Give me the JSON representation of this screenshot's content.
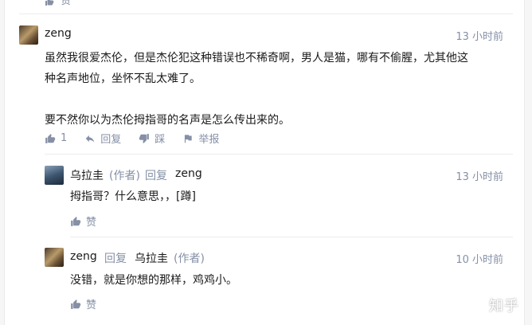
{
  "comments": [
    {
      "author": "zeng",
      "time": "13 小时前",
      "text_line1": "虽然我很爱杰伦，但是杰伦犯这种错误也不稀奇啊，男人是猫，哪有不偷腥，尤其他这",
      "text_line2": "种名声地位，坐怀不乱太难了。",
      "text_line3": "要不然你以为杰伦拇指哥的名声是怎么传出来的。",
      "likes": "1",
      "reply_label": "回复",
      "dislike_label": "踩",
      "report_label": "举报"
    },
    {
      "author": "乌拉圭",
      "author_tag": "(作者)",
      "reply_word": "回复",
      "reply_to": "zeng",
      "time": "13 小时前",
      "text": "拇指哥？什么意思，，[蹲]",
      "like_label": "赞"
    },
    {
      "author": "zeng",
      "reply_word": "回复",
      "reply_to": "乌拉圭",
      "reply_to_tag": "(作者)",
      "time": "10 小时前",
      "text": "没错，就是你想的那样，鸡鸡小。",
      "like_label": "赞"
    }
  ],
  "top_partial_label": "赞",
  "watermark": "知乎"
}
